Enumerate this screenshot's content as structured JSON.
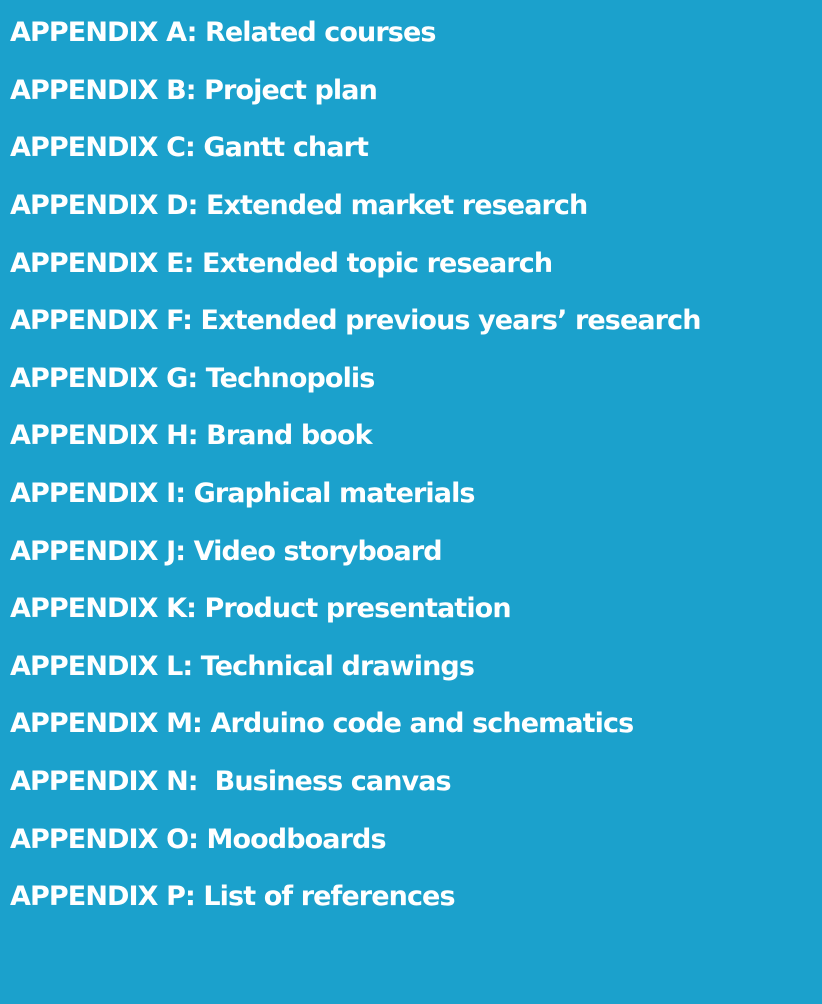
{
  "appendices": [
    "APPENDIX A: Related courses",
    "APPENDIX B: Project plan",
    "APPENDIX C: Gantt chart",
    "APPENDIX D: Extended market research",
    "APPENDIX E: Extended topic research",
    "APPENDIX F: Extended previous years’ research",
    "APPENDIX G: Technopolis",
    "APPENDIX H: Brand book",
    "APPENDIX I: Graphical materials",
    "APPENDIX J: Video storyboard",
    "APPENDIX K: Product presentation",
    "APPENDIX L: Technical drawings",
    "APPENDIX M: Arduino code and schematics",
    "APPENDIX N:  Business canvas",
    "APPENDIX O: Moodboards",
    "APPENDIX P: List of references"
  ],
  "colors": {
    "background": "#1ba1cc",
    "text": "#ffffff"
  }
}
